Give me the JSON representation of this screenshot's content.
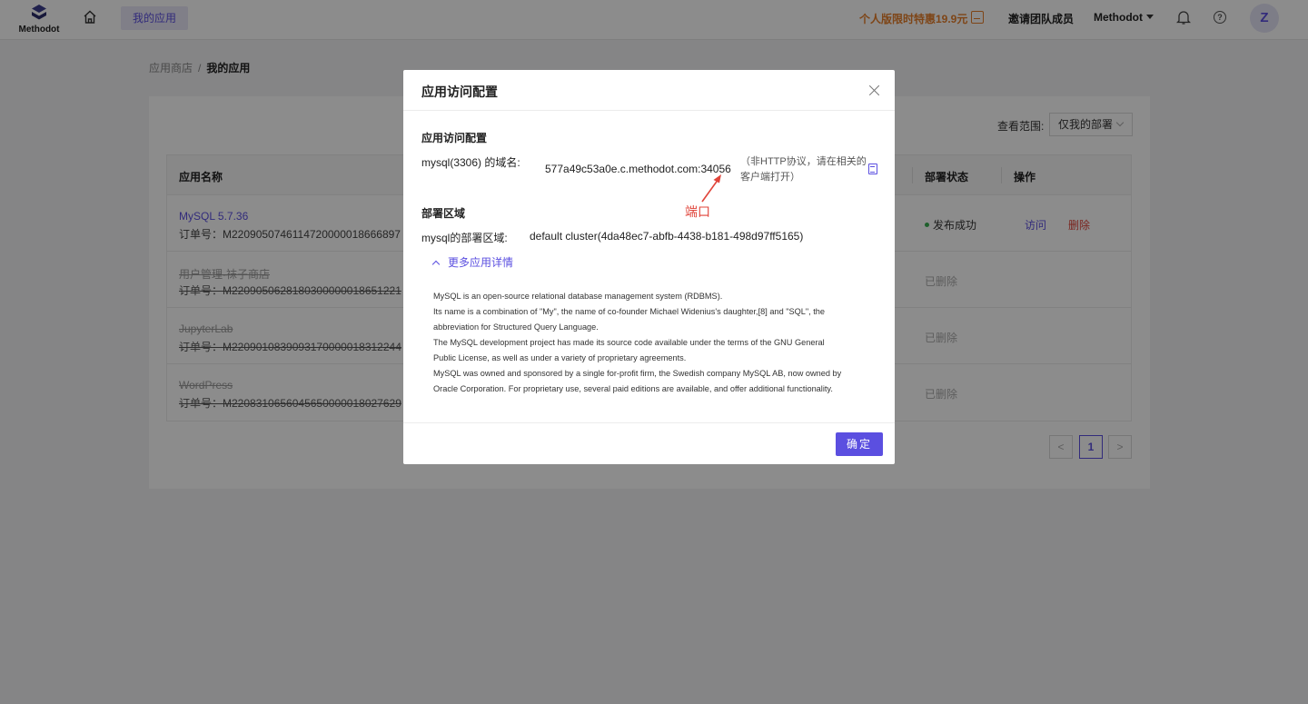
{
  "topbar": {
    "logo_text": "Methodot",
    "nav_tab": "我的应用",
    "promo": "个人版限时特惠19.9元",
    "invite": "邀请团队成员",
    "account": "Methodot",
    "avatar": "Z",
    "help": "?"
  },
  "breadcrumb": {
    "root": "应用商店",
    "sep": "/",
    "current": "我的应用"
  },
  "filter": {
    "label": "查看范围:",
    "value": "仅我的部署"
  },
  "table": {
    "columns": [
      "应用名称",
      "部署状态",
      "操作"
    ],
    "rows": [
      {
        "name": "MySQL 5.7.36",
        "order": "订单号：M2209050746114720000018666897",
        "status": "发布成功",
        "visit": "访问",
        "delete": "删除"
      },
      {
        "name": "用户管理-袜子商店",
        "order": "订单号：M2209050628180300000018651221",
        "status": "已删除"
      },
      {
        "name": "JupyterLab",
        "order": "订单号：M2209010839093170000018312244",
        "status": "已删除"
      },
      {
        "name": "WordPress",
        "order": "订单号：M2208310656045650000018027629",
        "status": "已删除"
      }
    ]
  },
  "pagination": {
    "prev": "<",
    "current": "1",
    "next": ">"
  },
  "modal": {
    "title": "应用访问配置",
    "section_access": "应用访问配置",
    "domain_label": "mysql(3306) 的域名:",
    "domain_value": "577a49c53a0e.c.methodot.com:34056",
    "note": "（非HTTP协议，请在相关的客户端打开）",
    "annotation": "端口",
    "section_region": "部署区域",
    "region_label": "mysql的部署区域:",
    "region_value": "default cluster(4da48ec7-abfb-4438-b181-498d97ff5165)",
    "more_toggle": "更多应用详情",
    "description": [
      "MySQL is an open-source relational database management system (RDBMS).",
      "Its name is a combination of \"My\", the name of co-founder Michael Widenius's daughter,[8] and \"SQL\", the",
      "abbreviation for Structured Query Language.",
      "The MySQL development project has made its source code available under the terms of the GNU General",
      "Public License, as well as under a variety of proprietary agreements.",
      "MySQL was owned and sponsored by a single for-profit firm, the Swedish company MySQL AB, now owned by",
      "Oracle Corporation.  For proprietary use, several paid editions are available, and offer additional functionality."
    ],
    "ok_label": "确定"
  },
  "colors": {
    "accent": "#5b4fe0",
    "danger": "#e0443a",
    "promo": "#e57e2a",
    "success": "#3aaf52"
  }
}
